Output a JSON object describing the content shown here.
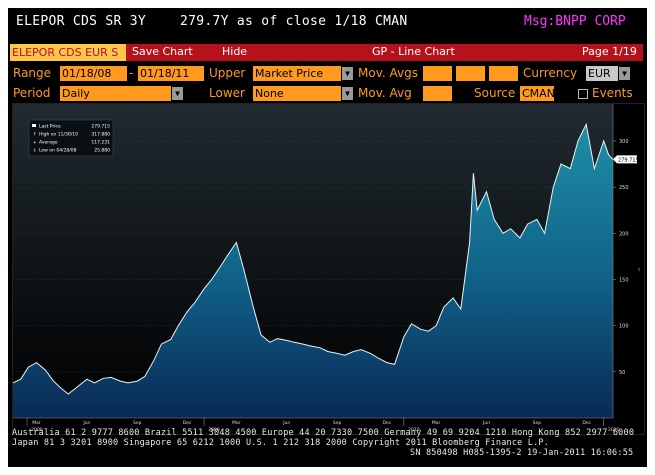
{
  "header": {
    "security": "ELEPOR CDS SR 3Y",
    "quote": "279.7Y as of close  1/18 CMAN",
    "message": "Msg:BNPP CORP"
  },
  "toolbar": {
    "ticker_tab": "ELEPOR CDS EUR S",
    "save_chart": "Save Chart",
    "hide": "Hide",
    "title": "GP - Line Chart",
    "page": "Page 1/19"
  },
  "controls": {
    "range_label": "Range",
    "range_start": "01/18/08",
    "range_dash": "-",
    "range_end": "01/18/11",
    "upper_label": "Upper",
    "upper_value": "Market Price",
    "mov_avgs_label": "Mov. Avgs",
    "currency_label": "Currency",
    "currency_value": "EUR",
    "period_label": "Period",
    "period_value": "Daily",
    "lower_label": "Lower",
    "lower_value": "None",
    "mov_avg_label": "Mov. Avg",
    "source_label": "Source",
    "source_value": "CMAN",
    "events_label": "Events"
  },
  "legend": {
    "rows": [
      {
        "label": "Last Price",
        "value": "279.715"
      },
      {
        "label": "High on 11/30/10",
        "value": "317.880"
      },
      {
        "label": "Average",
        "value": "117.231"
      },
      {
        "label": "Low on 04/28/08",
        "value": "25.880"
      }
    ]
  },
  "price_tag": "279.715",
  "chart_data": {
    "type": "area",
    "x_axis": "date",
    "ylim": [
      0,
      340
    ],
    "yticks": [
      50,
      100,
      150,
      200,
      250,
      300
    ],
    "grid": true,
    "legend_position": "top-left",
    "month_ticks": [
      "Mar",
      "Jun",
      "Sep",
      "Dec",
      "Mar",
      "Jun",
      "Sep",
      "Dec",
      "Mar",
      "Jun",
      "Sep",
      "Dec"
    ],
    "year_ticks": [
      "2008",
      "2009",
      "2010",
      "2011"
    ],
    "series": [
      {
        "x": [
          "2008-01-18",
          "2008-02-01",
          "2008-02-15",
          "2008-03-01",
          "2008-03-17",
          "2008-04-01",
          "2008-04-15",
          "2008-04-28",
          "2008-05-15",
          "2008-06-01",
          "2008-06-15",
          "2008-07-01",
          "2008-07-15",
          "2008-08-01",
          "2008-08-15",
          "2008-09-01",
          "2008-09-15",
          "2008-10-01",
          "2008-10-15",
          "2008-11-01",
          "2008-11-15",
          "2008-12-01",
          "2008-12-15",
          "2009-01-01",
          "2009-01-15",
          "2009-02-01",
          "2009-02-15",
          "2009-03-01",
          "2009-03-15",
          "2009-04-01",
          "2009-04-15",
          "2009-05-01",
          "2009-05-15",
          "2009-06-01",
          "2009-06-15",
          "2009-07-01",
          "2009-07-15",
          "2009-08-01",
          "2009-08-15",
          "2009-09-01",
          "2009-09-15",
          "2009-10-01",
          "2009-10-15",
          "2009-11-01",
          "2009-11-15",
          "2009-12-01",
          "2009-12-15",
          "2010-01-01",
          "2010-01-15",
          "2010-02-01",
          "2010-02-15",
          "2010-03-01",
          "2010-03-15",
          "2010-04-01",
          "2010-04-15",
          "2010-05-01",
          "2010-05-08",
          "2010-05-15",
          "2010-06-01",
          "2010-06-15",
          "2010-07-01",
          "2010-07-15",
          "2010-08-01",
          "2010-08-15",
          "2010-09-01",
          "2010-09-15",
          "2010-10-01",
          "2010-10-15",
          "2010-11-01",
          "2010-11-15",
          "2010-11-30",
          "2010-12-15",
          "2011-01-01",
          "2011-01-10",
          "2011-01-18"
        ],
        "y": [
          38,
          42,
          55,
          60,
          52,
          40,
          32,
          26,
          34,
          42,
          38,
          43,
          44,
          40,
          38,
          40,
          45,
          62,
          80,
          85,
          100,
          115,
          125,
          140,
          150,
          165,
          178,
          190,
          160,
          120,
          90,
          82,
          86,
          84,
          82,
          80,
          78,
          76,
          72,
          70,
          68,
          72,
          74,
          70,
          65,
          60,
          58,
          88,
          102,
          96,
          94,
          100,
          120,
          130,
          118,
          190,
          265,
          225,
          245,
          215,
          200,
          205,
          195,
          210,
          215,
          200,
          250,
          275,
          270,
          300,
          318,
          270,
          300,
          285,
          280
        ]
      }
    ]
  },
  "footer": {
    "line1": "Australia 61 2 9777 8600 Brazil 5511 3048 4500 Europe 44 20 7330 7500 Germany 49 69 9204 1210 Hong Kong 852 2977 6000",
    "line2": "Japan 81 3 3201 8900         Singapore 65 6212 1000        U.S. 1 212 318 2000          Copyright 2011 Bloomberg Finance L.P.",
    "line3": "SN 850498 H085-1395-2 19-Jan-2011 16:06:55"
  }
}
